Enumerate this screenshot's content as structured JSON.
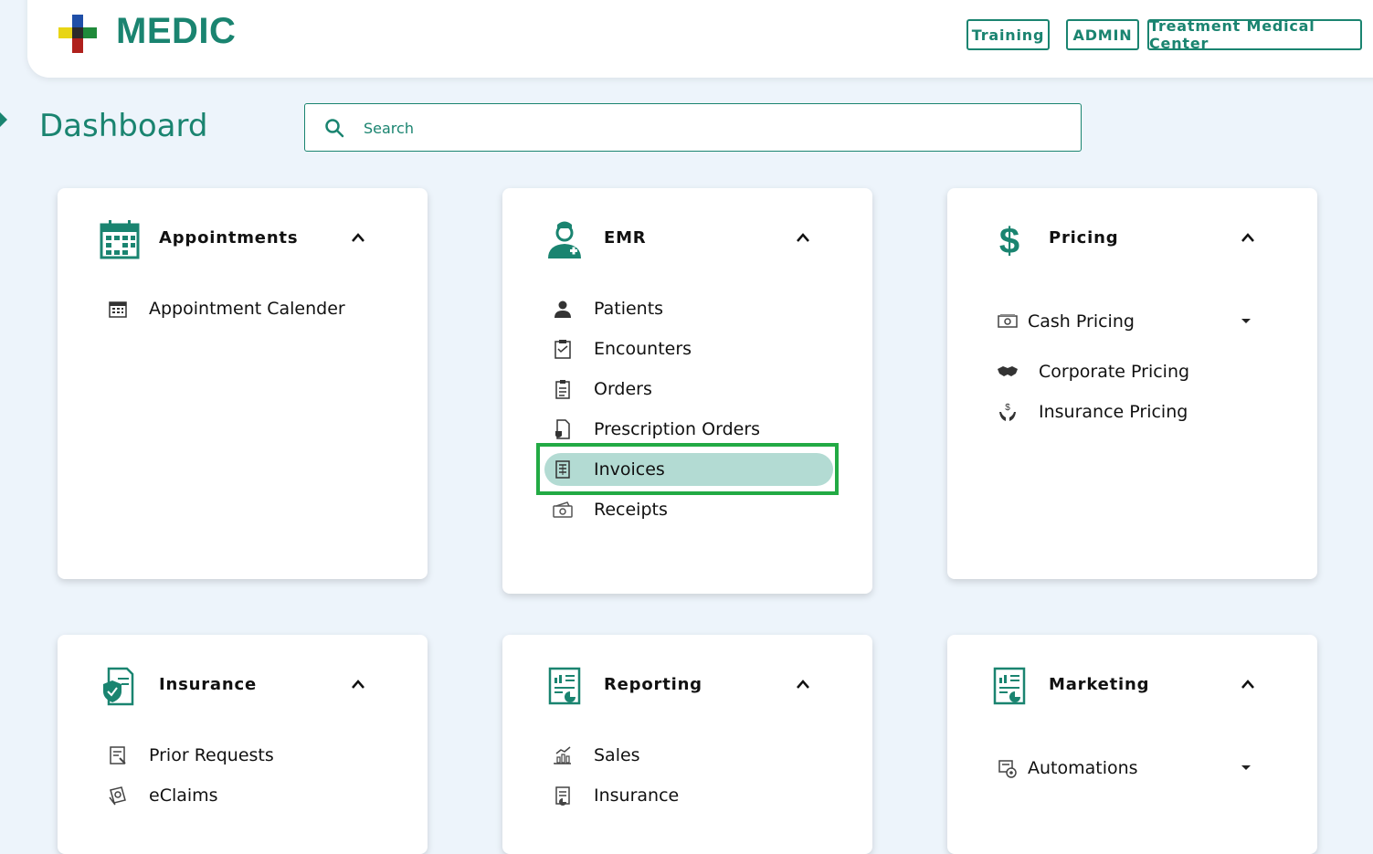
{
  "brand": {
    "name": "MEDIC"
  },
  "header": {
    "buttons": [
      "Training",
      "ADMIN",
      "Treatment Medical Center"
    ]
  },
  "page": {
    "title": "Dashboard"
  },
  "search": {
    "placeholder": "Search"
  },
  "colors": {
    "accent": "#1a8470",
    "selected_bg": "#b3dbd3",
    "highlight": "#22aa44"
  },
  "cards": {
    "appointments": {
      "title": "Appointments",
      "icon": "calendar-icon",
      "items": [
        "Appointment Calender"
      ]
    },
    "emr": {
      "title": "EMR",
      "icon": "doctor-icon",
      "items": [
        "Patients",
        "Encounters",
        "Orders",
        "Prescription Orders",
        "Invoices",
        "Receipts"
      ],
      "selected": "Invoices"
    },
    "pricing": {
      "title": "Pricing",
      "icon": "dollar-icon",
      "items": [
        "Cash Pricing",
        "Corporate Pricing",
        "Insurance Pricing"
      ]
    },
    "insurance": {
      "title": "Insurance",
      "icon": "insurance-doc-icon",
      "items": [
        "Prior Requests",
        "eClaims"
      ]
    },
    "reporting": {
      "title": "Reporting",
      "icon": "report-icon",
      "items": [
        "Sales",
        "Insurance"
      ]
    },
    "marketing": {
      "title": "Marketing",
      "icon": "report-icon",
      "items": [
        "Automations"
      ]
    }
  }
}
